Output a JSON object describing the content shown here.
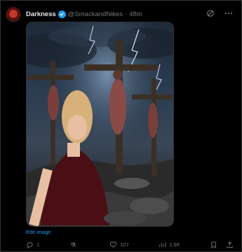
{
  "tweet": {
    "display_name": "Darkness",
    "handle": "@SmackandNikes",
    "separator": "·",
    "time": "48m"
  },
  "header_icons": [
    "grok-icon",
    "more-icon"
  ],
  "media": {
    "link_label": "Edit image"
  },
  "actions": {
    "replies": "1",
    "reposts": "",
    "likes": "107",
    "views": "1.5K"
  },
  "colors": {
    "background": "#000000",
    "text": "#e7e9ea",
    "muted": "#71767b",
    "accent": "#1d9bf0",
    "border": "#2f3336"
  }
}
